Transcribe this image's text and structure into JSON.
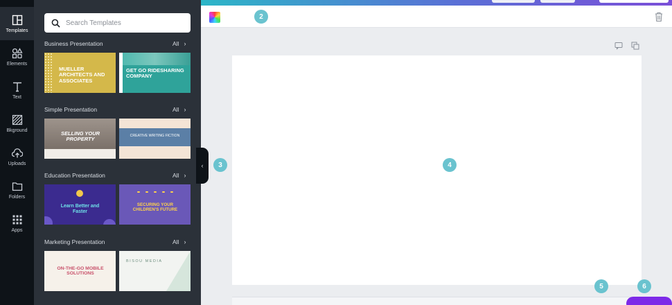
{
  "rail": [
    {
      "label": "Templates",
      "icon": "templates-icon",
      "active": true
    },
    {
      "label": "Elements",
      "icon": "elements-icon"
    },
    {
      "label": "Text",
      "icon": "text-icon"
    },
    {
      "label": "Bkground",
      "icon": "background-icon"
    },
    {
      "label": "Uploads",
      "icon": "uploads-icon"
    },
    {
      "label": "Folders",
      "icon": "folders-icon"
    },
    {
      "label": "Apps",
      "icon": "apps-icon"
    }
  ],
  "search": {
    "placeholder": "Search Templates"
  },
  "sections": [
    {
      "title": "Business Presentation",
      "all": "All",
      "templates": [
        {
          "text": "MUELLER ARCHITECTS AND ASSOCIATES",
          "bg": "#d4b84a",
          "fg": "#ffffff"
        },
        {
          "text": "GET GO RIDESHARING COMPANY",
          "bg": "#2fa39a",
          "fg": "#ffffff"
        }
      ]
    },
    {
      "title": "Simple Presentation",
      "all": "All",
      "templates": [
        {
          "text": "SELLING YOUR PROPERTY",
          "bg": "#8a7f78",
          "fg": "#ffffff"
        },
        {
          "text": "CREATIVE WRITING FICTION",
          "bg": "#5b7fa6",
          "fg": "#ffffff"
        }
      ]
    },
    {
      "title": "Education Presentation",
      "all": "All",
      "templates": [
        {
          "text": "Learn Better and Faster",
          "bg": "#3b2b8f",
          "fg": "#6fe0e8"
        },
        {
          "text": "SECURING YOUR CHILDREN'S FUTURE",
          "bg": "#6a58b8",
          "fg": "#ffd24a"
        }
      ]
    },
    {
      "title": "Marketing Presentation",
      "all": "All",
      "templates": [
        {
          "text": "ON-THE-GO MOBILE SOLUTIONS",
          "bg": "#f6f1ea",
          "fg": "#c8506a"
        },
        {
          "text": "BISOU MEDIA",
          "bg": "#f2f4f1",
          "fg": "#6f8f80"
        }
      ]
    }
  ],
  "badges": [
    "2",
    "3",
    "4",
    "5",
    "6"
  ],
  "colors": {
    "accent": "#7d2ae8",
    "badge": "#6ac3cf",
    "rail": "#0e1318",
    "panel": "#2b3139"
  }
}
